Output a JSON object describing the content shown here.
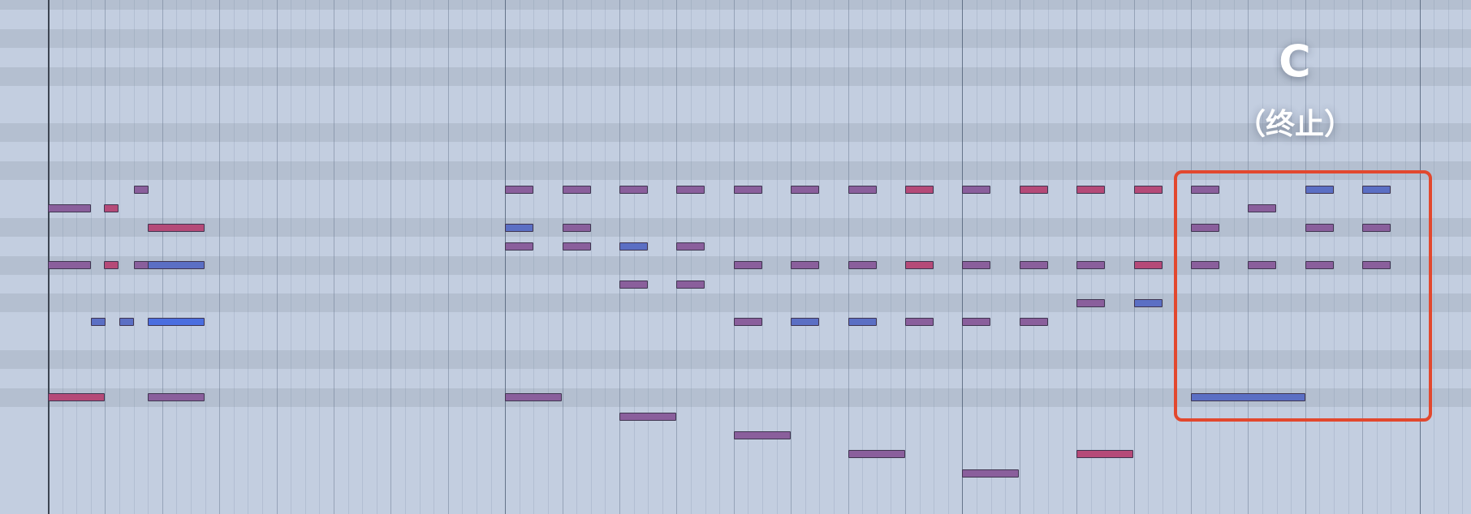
{
  "annotation": {
    "chord_letter": "C",
    "chord_function": "（终止）",
    "highlight_color": "#e2482e"
  },
  "note_colors": {
    "purple": "#8a5f9c",
    "magenta": "#b54a78",
    "blue": "#5b6fc4",
    "bright_blue": "#4a6ee0"
  }
}
